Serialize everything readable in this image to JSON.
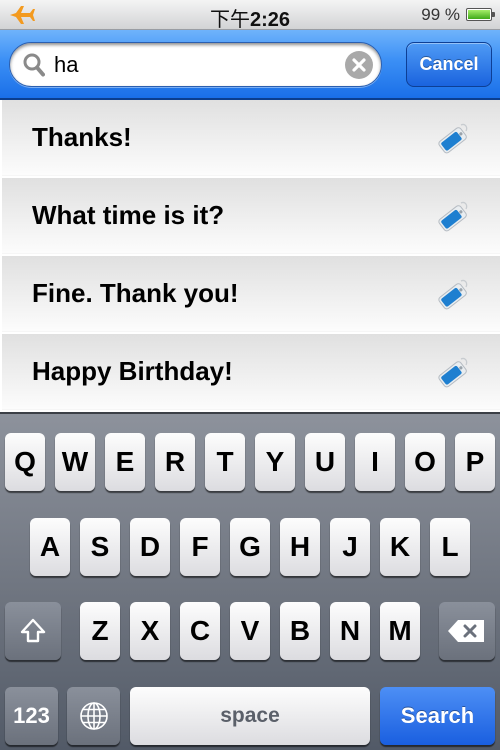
{
  "status_bar": {
    "airplane_icon": "airplane-icon",
    "time_prefix": "下午",
    "time": "2:26",
    "battery_percent": "99 %",
    "battery_level": 0.99,
    "colors": {
      "airplane": "#f39a1f",
      "battery_fill": "#4fbf22"
    }
  },
  "search": {
    "query": "ha",
    "placeholder": "",
    "search_icon": "magnifier-icon",
    "clear_icon": "clear-icon",
    "cancel_label": "Cancel"
  },
  "results": [
    {
      "text": "Thanks!",
      "icon": "tag-icon"
    },
    {
      "text": "What time is it?",
      "icon": "tag-icon"
    },
    {
      "text": "Fine. Thank you!",
      "icon": "tag-icon"
    },
    {
      "text": "Happy Birthday!",
      "icon": "tag-icon"
    }
  ],
  "keyboard": {
    "row1": [
      "Q",
      "W",
      "E",
      "R",
      "T",
      "Y",
      "U",
      "I",
      "O",
      "P"
    ],
    "row2": [
      "A",
      "S",
      "D",
      "F",
      "G",
      "H",
      "J",
      "K",
      "L"
    ],
    "row3": [
      "Z",
      "X",
      "C",
      "V",
      "B",
      "N",
      "M"
    ],
    "numbers_label": "123",
    "space_label": "space",
    "search_label": "Search",
    "shift_icon": "shift-icon",
    "globe_icon": "globe-icon",
    "backspace_icon": "backspace-icon"
  },
  "colors": {
    "accent_blue": "#1a6fe8",
    "tag_blue": "#1e7fd0"
  }
}
